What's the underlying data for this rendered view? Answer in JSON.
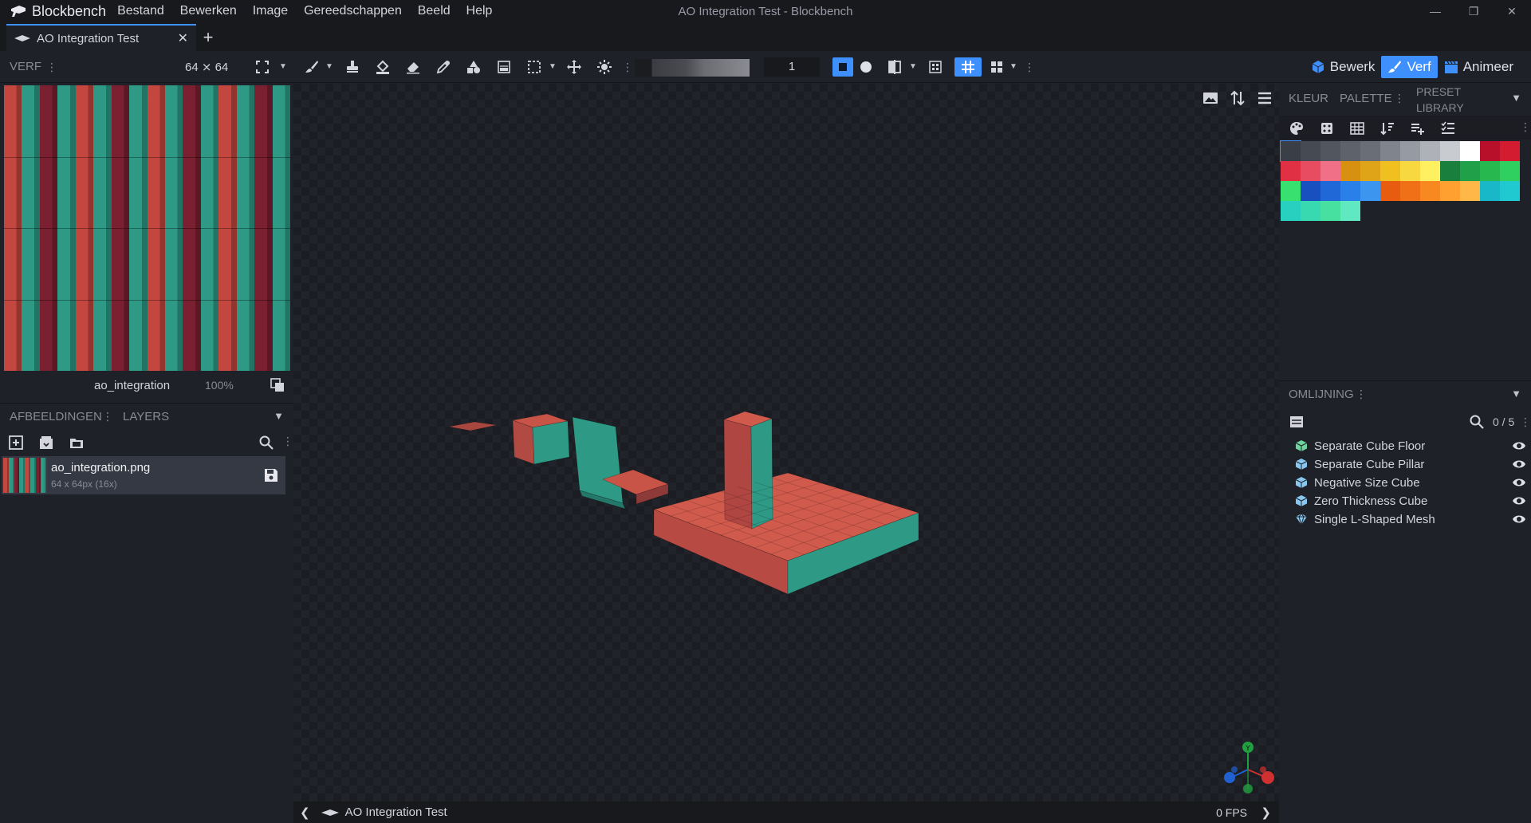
{
  "app": {
    "name": "Blockbench",
    "window_title": "AO Integration Test - Blockbench",
    "menu": [
      "Bestand",
      "Bewerken",
      "Image",
      "Gereedschappen",
      "Beeld",
      "Help"
    ]
  },
  "tabs": [
    {
      "label": "AO Integration Test"
    }
  ],
  "toolbar": {
    "panel_label": "VERF",
    "resolution": "64 ⨯ 64",
    "brush_size": "1",
    "modes": [
      {
        "label": "Bewerk",
        "active": false
      },
      {
        "label": "Verf",
        "active": true
      },
      {
        "label": "Animeer",
        "active": false
      }
    ]
  },
  "uv_editor": {
    "texture_name": "ao_integration",
    "zoom": "100%"
  },
  "images_panel": {
    "tab_images": "AFBEELDINGEN",
    "tab_layers": "LAYERS",
    "texture": {
      "name": "ao_integration.png",
      "size": "64 x 64px (16x)"
    }
  },
  "color_panel": {
    "tab_color": "KLEUR",
    "tab_palette": "PALETTE",
    "tab_preset_line1": "PRESET",
    "tab_preset_line2": "LIBRARY",
    "palette": [
      "#3a3e46",
      "#464a52",
      "#52565e",
      "#5e626a",
      "#6a6e76",
      "#80848c",
      "#969aa2",
      "#aeb2b8",
      "#c8cbd0",
      "#ffffff",
      "#b8102a",
      "#d41c30",
      "#e03044",
      "#e84c60",
      "#f07088",
      "#d89010",
      "#e0a418",
      "#f0c020",
      "#f8d840",
      "#fff060",
      "#18803c",
      "#20a048",
      "#28b850",
      "#30d060",
      "#38e070",
      "#1850c0",
      "#2068d8",
      "#2880e8",
      "#3c96f0",
      "#e85c10",
      "#f07018",
      "#f88820",
      "#ffa030",
      "#ffb848",
      "#18b8c8",
      "#20c8d0",
      "#28d0c0",
      "#38d8b0",
      "#48e0a0",
      "#60e8c0"
    ]
  },
  "outliner": {
    "title": "OMLIJNING",
    "count": "0 / 5",
    "items": [
      {
        "name": "Separate Cube Floor",
        "icon": "cube-icon"
      },
      {
        "name": "Separate Cube Pillar",
        "icon": "cube-icon"
      },
      {
        "name": "Negative Size Cube",
        "icon": "cube-icon"
      },
      {
        "name": "Zero Thickness Cube",
        "icon": "cube-icon"
      },
      {
        "name": "Single L-Shaped Mesh",
        "icon": "mesh-icon"
      }
    ]
  },
  "statusbar": {
    "project": "AO Integration Test",
    "fps": "0 FPS"
  },
  "colors": {
    "accent": "#3e90ff",
    "texture_red": "#c4473f",
    "texture_teal": "#2e9a86",
    "texture_dark_red": "#7a2030"
  }
}
